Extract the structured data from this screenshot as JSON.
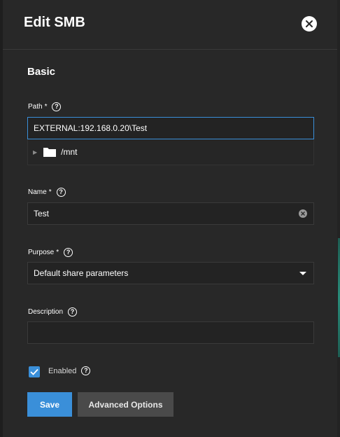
{
  "dialog": {
    "title": "Edit SMB",
    "section": "Basic"
  },
  "fields": {
    "path": {
      "label": "Path",
      "required": "*",
      "value": "EXTERNAL:192.168.0.20\\Test",
      "tree_item": "/mnt"
    },
    "name": {
      "label": "Name",
      "required": "*",
      "value": "Test"
    },
    "purpose": {
      "label": "Purpose",
      "required": "*",
      "value": "Default share parameters"
    },
    "description": {
      "label": "Description",
      "value": ""
    },
    "enabled": {
      "label": "Enabled",
      "checked": true
    }
  },
  "help_glyph": "?",
  "buttons": {
    "save": "Save",
    "advanced": "Advanced Options"
  },
  "icons": {
    "close": "close-icon",
    "help": "help-circle-icon",
    "folder": "folder-icon",
    "caret": "caret-right-icon",
    "clear": "clear-icon",
    "dropdown": "dropdown-arrow-icon",
    "check": "check-icon"
  },
  "colors": {
    "accent": "#3a8fd9",
    "panel_bg": "#282828",
    "input_bg": "#232323",
    "secondary_button": "#4a4a4a"
  }
}
